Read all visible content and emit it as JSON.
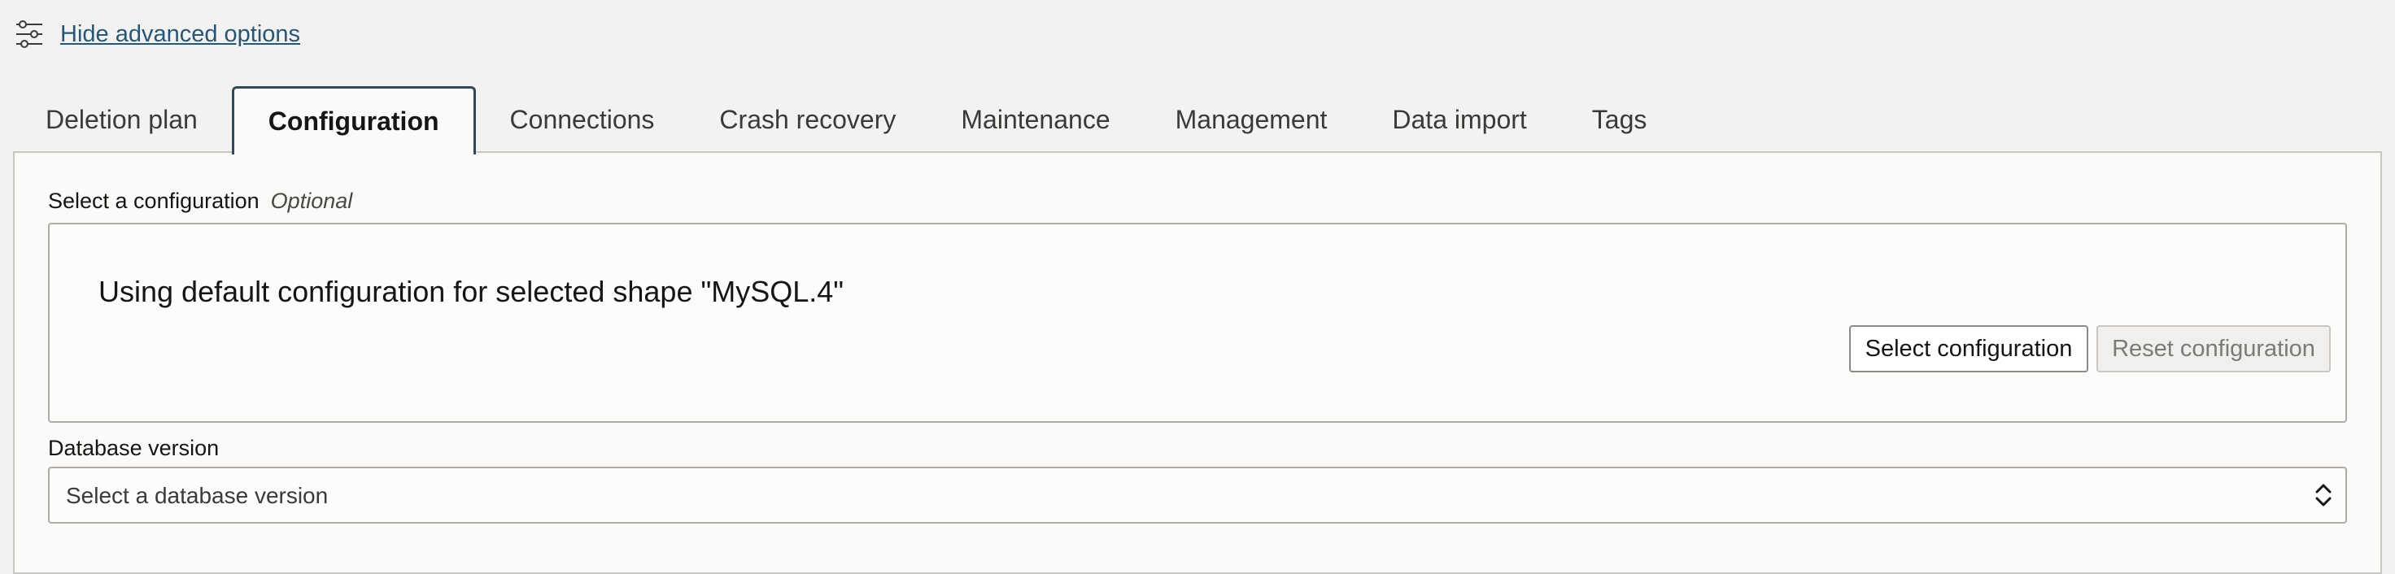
{
  "advanced": {
    "icon": "sliders-icon",
    "link_label": "Hide advanced options"
  },
  "tabs": [
    {
      "label": "Deletion plan",
      "active": false
    },
    {
      "label": "Configuration",
      "active": true
    },
    {
      "label": "Connections",
      "active": false
    },
    {
      "label": "Crash recovery",
      "active": false
    },
    {
      "label": "Maintenance",
      "active": false
    },
    {
      "label": "Management",
      "active": false
    },
    {
      "label": "Data import",
      "active": false
    },
    {
      "label": "Tags",
      "active": false
    }
  ],
  "configuration": {
    "label": "Select a configuration",
    "optional_label": "Optional",
    "status_text": "Using default configuration for selected shape \"MySQL.4\"",
    "select_button": "Select configuration",
    "reset_button": "Reset configuration",
    "reset_disabled": true
  },
  "database_version": {
    "label": "Database version",
    "placeholder": "Select a database version",
    "icon": "chevron-up-down-icon"
  },
  "colors": {
    "link": "#24587a",
    "active_tab_border": "#2d4a5c",
    "page_bg": "#f3f2f1",
    "panel_bg": "#fbfaf9"
  }
}
